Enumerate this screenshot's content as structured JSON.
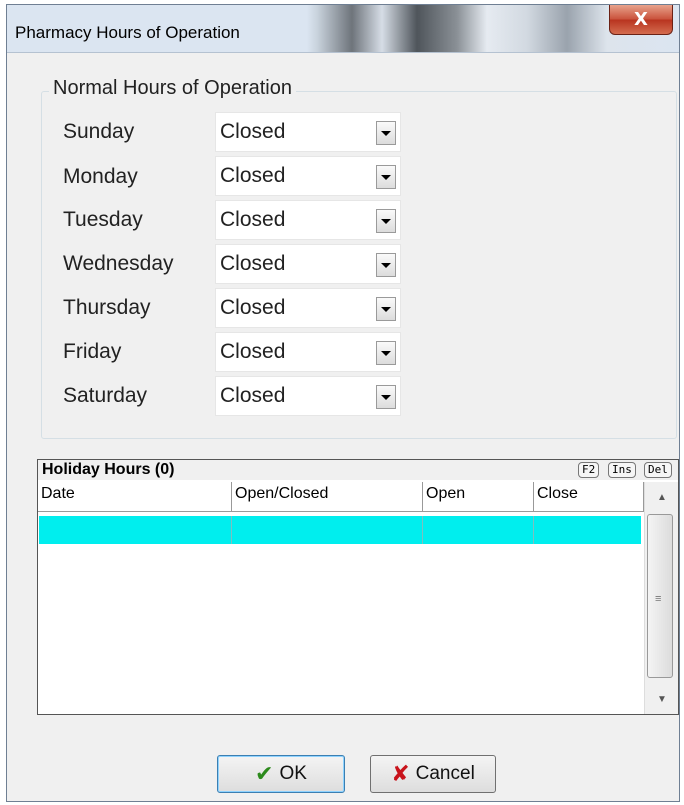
{
  "window": {
    "title": "Pharmacy Hours of Operation",
    "close_glyph": "X"
  },
  "normal_hours": {
    "legend": "Normal Hours of Operation",
    "days": [
      {
        "label": "Sunday",
        "value": "Closed"
      },
      {
        "label": "Monday",
        "value": "Closed"
      },
      {
        "label": "Tuesday",
        "value": "Closed"
      },
      {
        "label": "Wednesday",
        "value": "Closed"
      },
      {
        "label": "Thursday",
        "value": "Closed"
      },
      {
        "label": "Friday",
        "value": "Closed"
      },
      {
        "label": "Saturday",
        "value": "Closed"
      }
    ]
  },
  "holiday": {
    "title": "Holiday Hours (0)",
    "keys": [
      "F2",
      "Ins",
      "Del"
    ],
    "columns": [
      "Date",
      "Open/Closed",
      "Open",
      "Close"
    ],
    "selected_row_color": "#00eeee"
  },
  "buttons": {
    "ok": "OK",
    "cancel": "Cancel"
  }
}
